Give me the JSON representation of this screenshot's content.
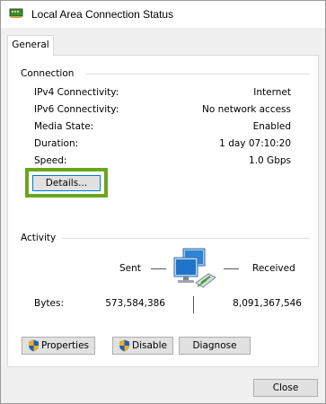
{
  "window": {
    "title": "Local Area Connection Status",
    "icon": "network-adapter-icon"
  },
  "tabs": [
    {
      "label": "General",
      "selected": true
    }
  ],
  "connection": {
    "heading": "Connection",
    "rows": [
      {
        "label": "IPv4 Connectivity:",
        "value": "Internet"
      },
      {
        "label": "IPv6 Connectivity:",
        "value": "No network access"
      },
      {
        "label": "Media State:",
        "value": "Enabled"
      },
      {
        "label": "Duration:",
        "value": "1 day 07:10:20"
      },
      {
        "label": "Speed:",
        "value": "1.0 Gbps"
      }
    ],
    "details_button": "Details..."
  },
  "activity": {
    "heading": "Activity",
    "sent_label": "Sent",
    "received_label": "Received",
    "bytes_label": "Bytes:",
    "bytes_sent": "573,584,386",
    "bytes_received": "8,091,367,546",
    "icon": "network-computers-icon"
  },
  "buttons": {
    "properties": "Properties",
    "disable": "Disable",
    "diagnose": "Diagnose",
    "close": "Close"
  },
  "colors": {
    "highlight": "#6aa51e",
    "focus": "#0078d7"
  }
}
